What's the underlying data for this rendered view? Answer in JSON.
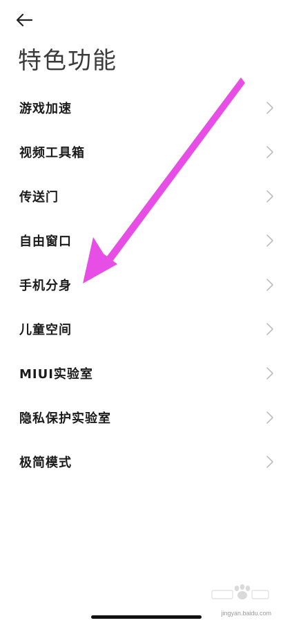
{
  "header": {
    "back_icon": "arrow-left-icon",
    "title": "特色功能"
  },
  "menu": {
    "chevron_icon": "chevron-right-icon",
    "items": [
      {
        "label": "游戏加速"
      },
      {
        "label": "视频工具箱"
      },
      {
        "label": "传送门"
      },
      {
        "label": "自由窗口"
      },
      {
        "label": "手机分身"
      },
      {
        "label": "儿童空间"
      },
      {
        "label": "MIUI实验室"
      },
      {
        "label": "隐私保护实验室"
      },
      {
        "label": "极简模式"
      }
    ]
  },
  "annotation": {
    "arrow_color": "#e64ee6",
    "points_to": "手机分身"
  },
  "watermark": {
    "text": "jingyan.baidu.com"
  },
  "colors": {
    "background": "#ffffff",
    "title_text": "#3a3a3a",
    "item_text": "#1a1a1a",
    "chevron": "#bdbdbd"
  }
}
